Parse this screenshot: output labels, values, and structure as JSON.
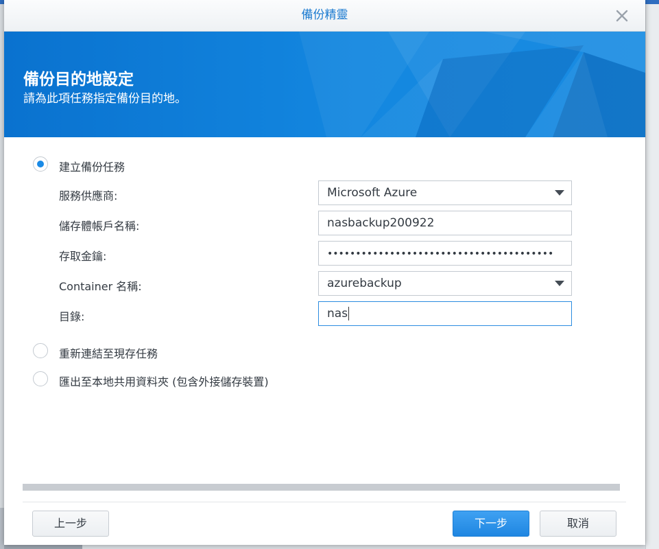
{
  "dialog": {
    "title": "備份精靈"
  },
  "banner": {
    "title": "備份目的地設定",
    "subtitle": "請為此項任務指定備份目的地。"
  },
  "options": {
    "create_task": "建立備份任務",
    "relink_task": "重新連結至現存任務",
    "export_local": "匯出至本地共用資料夾 (包含外接儲存裝置)"
  },
  "form": {
    "provider_label": "服務供應商:",
    "provider_value": "Microsoft Azure",
    "account_label": "儲存體帳戶名稱:",
    "account_value": "nasbackup200922",
    "key_label": "存取金鑰:",
    "key_value": "••••••••••••••••••••••••••••••••••••••••",
    "container_label": "Container 名稱:",
    "container_value": "azurebackup",
    "directory_label": "目錄:",
    "directory_value": "nas"
  },
  "buttons": {
    "back": "上一步",
    "next": "下一步",
    "cancel": "取消"
  },
  "colors": {
    "accent": "#1a8ae6",
    "banner": "#1387e0",
    "title": "#1a7ad0"
  },
  "icons": {
    "close": "close-icon",
    "dropdown": "chevron-down-icon"
  }
}
